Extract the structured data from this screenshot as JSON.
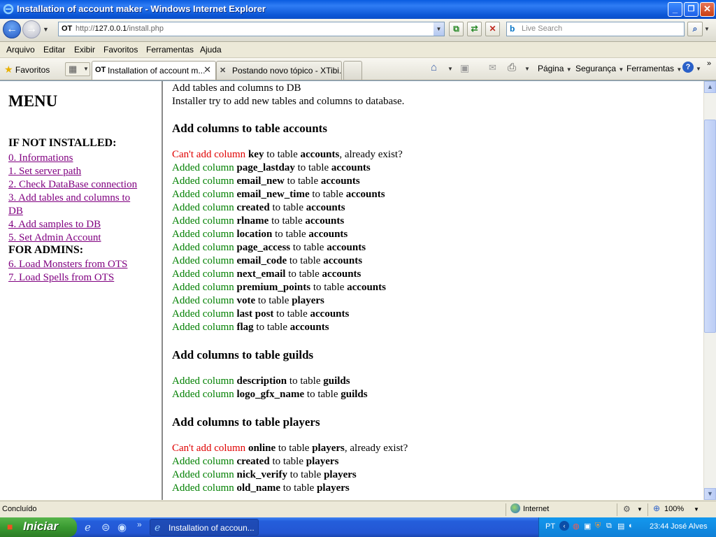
{
  "window": {
    "title": "Installation of account maker - Windows Internet Explorer",
    "min_glyph": "_",
    "max_glyph": "❐",
    "close_glyph": "✕"
  },
  "nav": {
    "favicon_text": "OT",
    "url_prefix": "http://",
    "url_host": "127.0.0.1",
    "url_path": "/install.php",
    "search_placeholder": "Live Search"
  },
  "menubar": [
    "Arquivo",
    "Editar",
    "Exibir",
    "Favoritos",
    "Ferramentas",
    "Ajuda"
  ],
  "tabbar": {
    "favorites_label": "Favoritos",
    "tabs": [
      {
        "icon": "OT",
        "label": "Installation of account m..."
      },
      {
        "icon": "✕",
        "label": "Postando novo tópico - XTibi..."
      }
    ],
    "commands": {
      "page": "Página",
      "security": "Segurança",
      "tools": "Ferramentas"
    }
  },
  "sidebar": {
    "heading": "MENU",
    "section_not_installed": "IF NOT INSTALLED:",
    "links": [
      "0. Informations",
      "1. Set server path",
      "2. Check DataBase connection",
      "3. Add tables and columns to DB",
      "4. Add samples to DB",
      "5. Set Admin Account"
    ],
    "section_admins": "FOR ADMINS:",
    "admin_links": [
      "6. Load Monsters from OTS",
      "7. Load Spells from OTS"
    ]
  },
  "main": {
    "title": "Add tables and columns to DB",
    "subtitle": "Installer try to add new tables and columns to database.",
    "accounts_heading": "Add columns to table accounts",
    "guilds_heading": "Add columns to table guilds",
    "players_heading": "Add columns to table players",
    "words": {
      "added": "Added column",
      "cant": "Can't add column",
      "to_table": "to table",
      "already": ", already exist?"
    },
    "accounts_rows": [
      {
        "status": "cant",
        "column": "key",
        "table": "accounts"
      },
      {
        "status": "added",
        "column": "page_lastday",
        "table": "accounts"
      },
      {
        "status": "added",
        "column": "email_new",
        "table": "accounts"
      },
      {
        "status": "added",
        "column": "email_new_time",
        "table": "accounts"
      },
      {
        "status": "added",
        "column": "created",
        "table": "accounts"
      },
      {
        "status": "added",
        "column": "rlname",
        "table": "accounts"
      },
      {
        "status": "added",
        "column": "location",
        "table": "accounts"
      },
      {
        "status": "added",
        "column": "page_access",
        "table": "accounts"
      },
      {
        "status": "added",
        "column": "email_code",
        "table": "accounts"
      },
      {
        "status": "added",
        "column": "next_email",
        "table": "accounts"
      },
      {
        "status": "added",
        "column": "premium_points",
        "table": "accounts"
      },
      {
        "status": "added",
        "column": "vote",
        "table": "players"
      },
      {
        "status": "added",
        "column": "last post",
        "table": "accounts"
      },
      {
        "status": "added",
        "column": "flag",
        "table": "accounts"
      }
    ],
    "guilds_rows": [
      {
        "status": "added",
        "column": "description",
        "table": "guilds"
      },
      {
        "status": "added",
        "column": "logo_gfx_name",
        "table": "guilds"
      }
    ],
    "players_rows": [
      {
        "status": "cant",
        "column": "online",
        "table": "players"
      },
      {
        "status": "added",
        "column": "created",
        "table": "players"
      },
      {
        "status": "added",
        "column": "nick_verify",
        "table": "players"
      },
      {
        "status": "added",
        "column": "old_name",
        "table": "players"
      }
    ]
  },
  "statusbar": {
    "status": "Concluído",
    "zone": "Internet",
    "zoom": "100%"
  },
  "taskbar": {
    "start": "Iniciar",
    "task": "Installation of accoun...",
    "language": "PT",
    "clock": "23:44",
    "user": "José Alves"
  },
  "colors": {
    "added": "#008000",
    "cant": "#e00000",
    "visited_link": "#800080"
  }
}
